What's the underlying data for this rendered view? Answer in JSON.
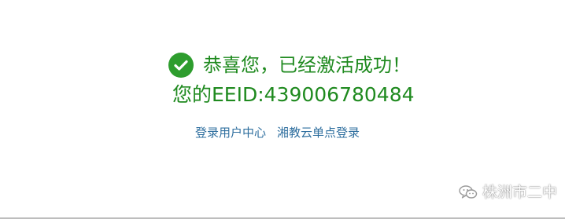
{
  "success": {
    "message": "恭喜您，已经激活成功！",
    "eeid_text": "您的EEID:439006780484"
  },
  "links": {
    "user_center": "登录用户中心",
    "single_sign_on": "湘教云单点登录"
  },
  "watermark": {
    "text": "株洲市二中",
    "icon": "wechat-icon"
  },
  "colors": {
    "success": "#1f8a1f",
    "link": "#2f6f9f"
  }
}
